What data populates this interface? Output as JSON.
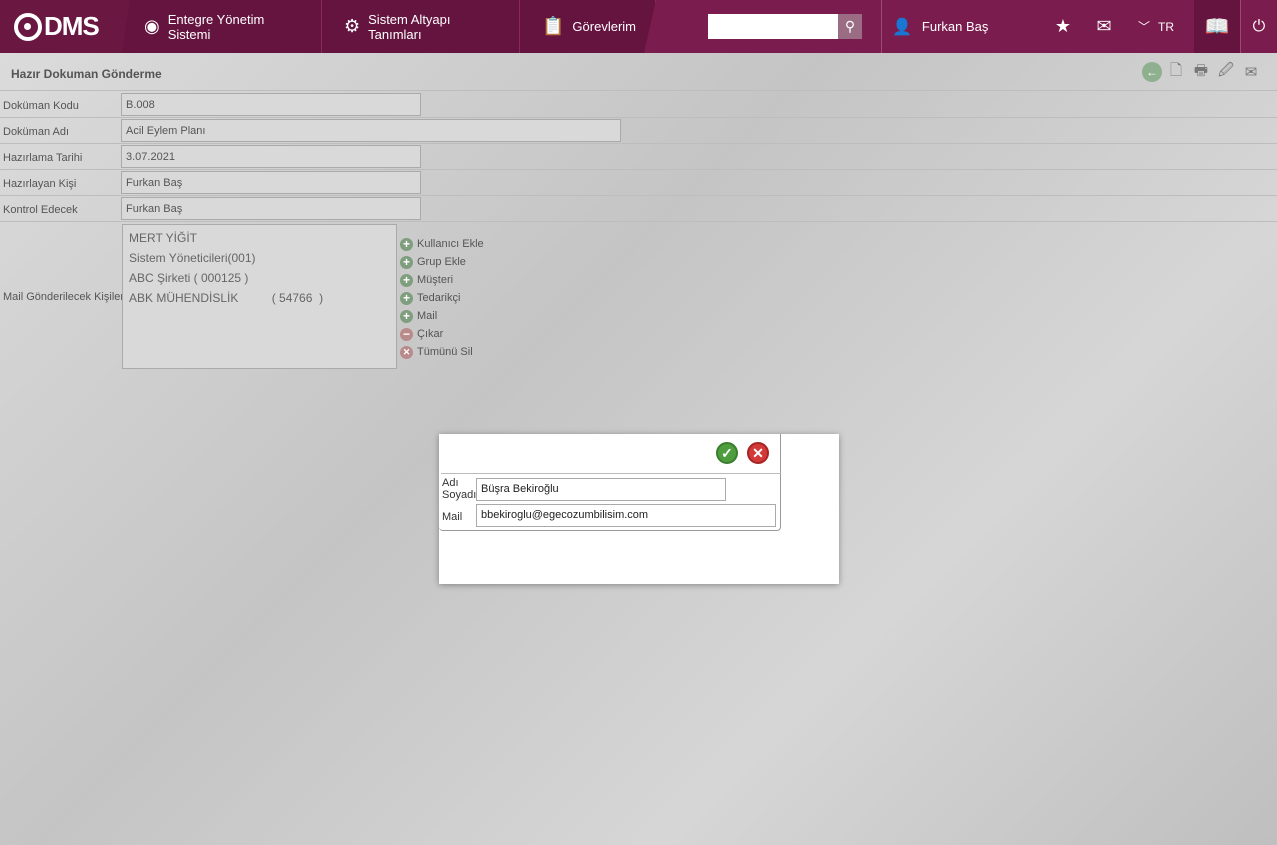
{
  "nav": {
    "logo": "DMS",
    "items": [
      {
        "label": "Entegre Yönetim Sistemi",
        "icon": "q-logo-icon"
      },
      {
        "label": "Sistem Altyapı Tanımları",
        "icon": "gear-icon"
      },
      {
        "label": "Görevlerim",
        "icon": "clipboard-icon"
      }
    ],
    "search_value": "",
    "user": "Furkan Baş",
    "lang": "TR"
  },
  "page": {
    "title": "Hazır Dokuman Gönderme",
    "fields": [
      {
        "label": "Doküman Kodu",
        "value": "B.008"
      },
      {
        "label": "Doküman Adı",
        "value": "Acil Eylem Planı"
      },
      {
        "label": "Hazırlama Tarihi",
        "value": "3.07.2021"
      },
      {
        "label": "Hazırlayan Kişi",
        "value": "Furkan Baş"
      },
      {
        "label": "Kontrol Edecek",
        "value": "Furkan Baş"
      }
    ],
    "recipients_label": "Mail Gönderilecek Kişiler",
    "recipients": [
      "MERT YİĞİT",
      "Sistem Yöneticileri(001)",
      "ABC Şirketi  ( 000125 )",
      "ABK MÜHENDİSLİK          ( 54766  )"
    ],
    "actions": [
      {
        "label": "Kullanıcı Ekle",
        "type": "add"
      },
      {
        "label": "Grup Ekle",
        "type": "add"
      },
      {
        "label": "Müşteri",
        "type": "add"
      },
      {
        "label": "Tedarikçi",
        "type": "add"
      },
      {
        "label": "Mail",
        "type": "add"
      },
      {
        "label": "Çıkar",
        "type": "remove"
      },
      {
        "label": "Tümünü Sil",
        "type": "clear"
      }
    ]
  },
  "modal": {
    "name_label": "Adı Soyadı",
    "name_value": "Büşra Bekiroğlu",
    "mail_label": "Mail",
    "mail_value": "bbekiroglu@egecozumbilisim.com"
  }
}
